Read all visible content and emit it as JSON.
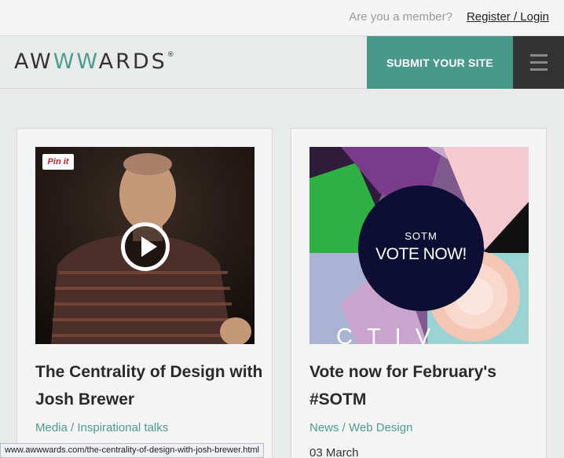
{
  "topbar": {
    "member_question": "Are you a member?",
    "register_login": "Register / Login"
  },
  "header": {
    "logo_left": "AW",
    "logo_mid": "WW",
    "logo_right": "ARDS",
    "logo_reg": "®",
    "submit_label": "SUBMIT YOUR SITE",
    "brand_color": "#49998a"
  },
  "cards": [
    {
      "title": "The Centrality of Design with Josh Brewer",
      "categories": "Media / Inspirational talks",
      "pin_label": "Pin it",
      "thumb_icon": "play-icon"
    },
    {
      "title": "Vote now for February's #SOTM",
      "categories": "News / Web Design",
      "date": "03 March",
      "sotm_small": "SOTM",
      "sotm_big": "VOTE NOW!",
      "art_text": "CTIV"
    }
  ],
  "status_bar": {
    "url": "www.awwwards.com/the-centrality-of-design-with-josh-brewer.html"
  }
}
